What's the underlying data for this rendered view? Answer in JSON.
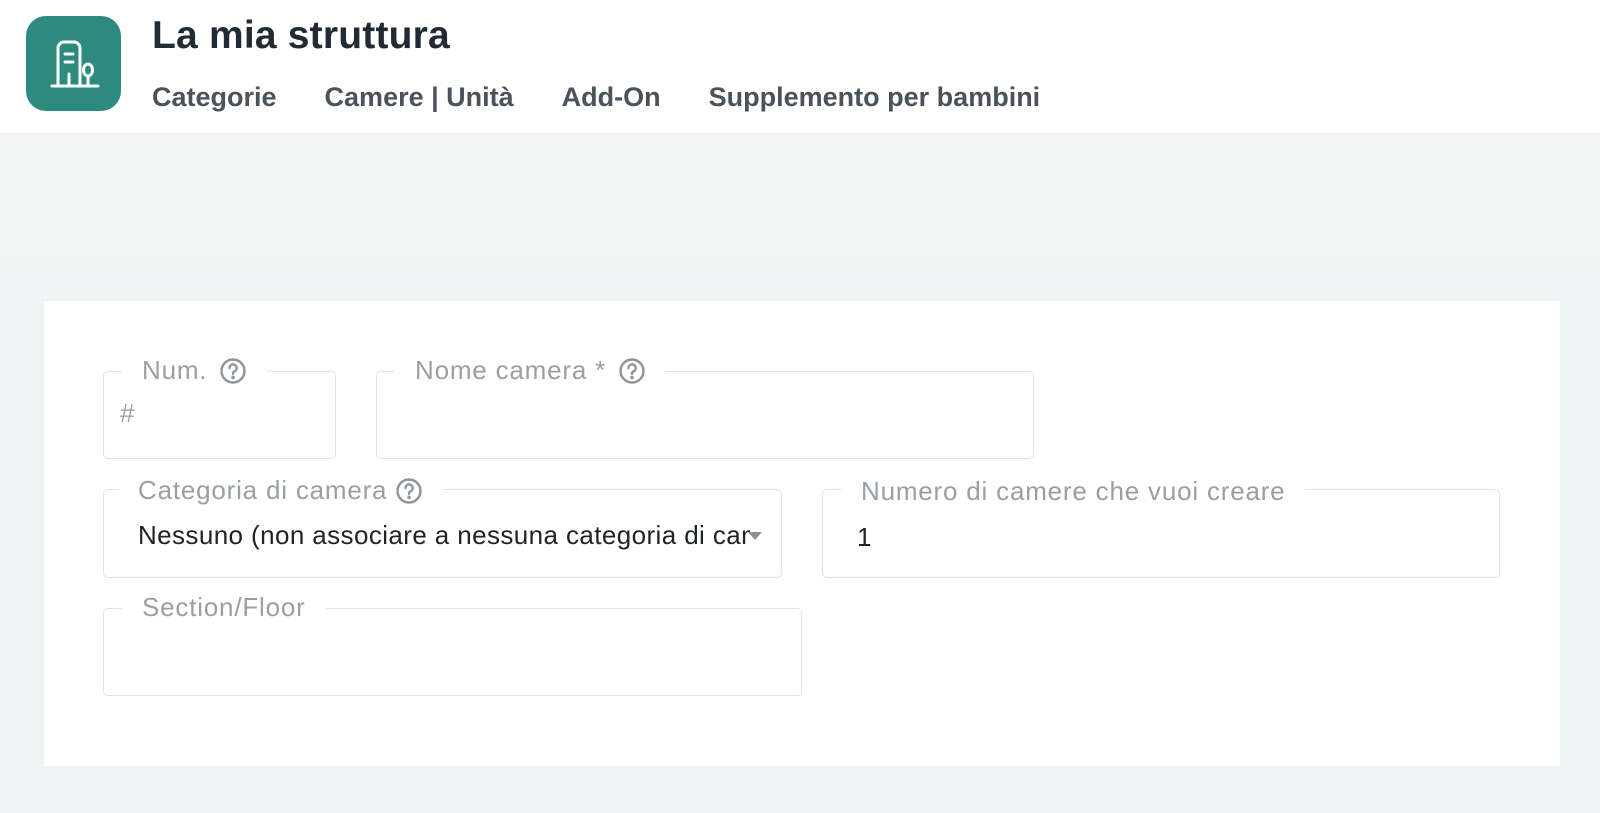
{
  "header": {
    "title": "La mia struttura",
    "app_icon": "building-icon",
    "accent_color": "#2d8a7e",
    "tabs": [
      {
        "label": "Categorie"
      },
      {
        "label": "Camere | Unità"
      },
      {
        "label": "Add-On"
      },
      {
        "label": "Supplemento per bambini"
      }
    ]
  },
  "form": {
    "num": {
      "label": "Num.",
      "placeholder": "#",
      "help_icon": "help-circle-icon"
    },
    "room_name": {
      "label": "Nome camera *",
      "value": "",
      "help_icon": "help-circle-icon"
    },
    "room_category": {
      "label": "Categoria di camera",
      "selected": "Nessuno (non associare a nessuna categoria di camera)",
      "help_icon": "help-circle-icon"
    },
    "rooms_to_create": {
      "label": "Numero di camere che vuoi creare",
      "value": "1"
    },
    "section_floor": {
      "label": "Section/Floor",
      "value": ""
    }
  }
}
